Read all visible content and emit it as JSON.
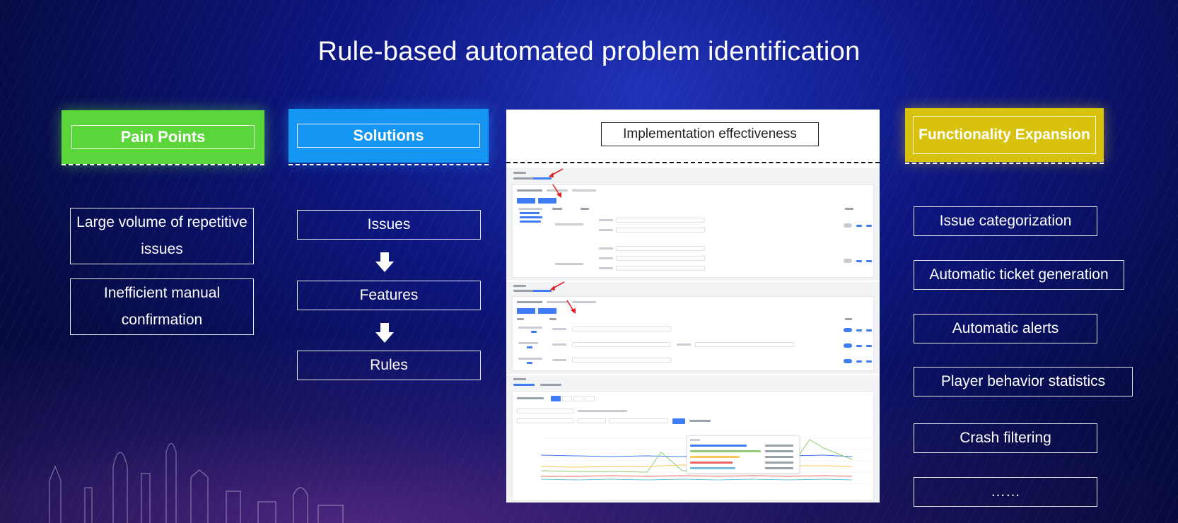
{
  "title": "Rule-based automated problem identification",
  "pain_points": {
    "header": "Pain Points",
    "items": [
      "Large volume of repetitive issues",
      "Inefficient manual confirmation"
    ]
  },
  "solutions": {
    "header": "Solutions",
    "steps": [
      "Issues",
      "Features",
      "Rules"
    ]
  },
  "implementation": {
    "header": "Implementation effectiveness"
  },
  "functionality": {
    "header": "Functionality Expansion",
    "items": [
      "Issue categorization",
      "Automatic ticket generation",
      "Automatic alerts",
      "Player behavior statistics",
      "Crash filtering",
      "……"
    ]
  },
  "colors": {
    "pain_header": "#5bd63a",
    "solutions_header": "#1496f2",
    "functionality_header": "#d9c20e",
    "background": "#0d1680"
  },
  "icons": [
    "down-arrow-icon",
    "red-pointer-arrow-icon",
    "city-skyline-graphic"
  ]
}
